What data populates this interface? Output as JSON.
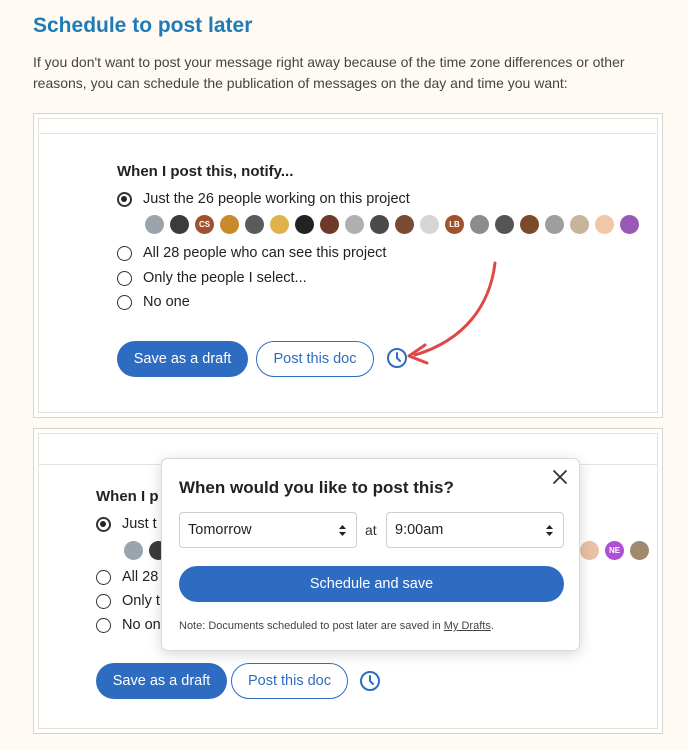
{
  "article": {
    "heading": "Schedule to post later",
    "intro": "If you don't want to post your message right away because of the time zone differences or other reasons, you can schedule the publication of messages on the day and time you want:"
  },
  "notify": {
    "title": "When I post this, notify...",
    "title_partial": "When I p",
    "options": [
      {
        "label": "Just the 26 people working on this project",
        "selected": true
      },
      {
        "label": "All 28 people who can see this project",
        "selected": false
      },
      {
        "label": "Only the people I select...",
        "selected": false
      },
      {
        "label": "No one",
        "selected": false
      }
    ],
    "options_partial": [
      "Just t",
      "All 28",
      "Only t",
      "No on"
    ],
    "avatars_top": [
      {
        "initials": "",
        "color": "#9aa4ad"
      },
      {
        "initials": "",
        "color": "#3b3b3b"
      },
      {
        "initials": "CS",
        "color": "#a0522d"
      },
      {
        "initials": "",
        "color": "#c98a2b"
      },
      {
        "initials": "",
        "color": "#5b5b5b"
      },
      {
        "initials": "",
        "color": "#e0b24a"
      },
      {
        "initials": "",
        "color": "#222222"
      },
      {
        "initials": "",
        "color": "#6b3a2a"
      },
      {
        "initials": "",
        "color": "#b0b0b0"
      },
      {
        "initials": "",
        "color": "#4a4a4a"
      },
      {
        "initials": "",
        "color": "#7a4a33"
      },
      {
        "initials": "",
        "color": "#d6d6d6"
      },
      {
        "initials": "LB",
        "color": "#a0522d"
      },
      {
        "initials": "",
        "color": "#8c8c8c"
      },
      {
        "initials": "",
        "color": "#555555"
      },
      {
        "initials": "",
        "color": "#7b4a2a"
      },
      {
        "initials": "",
        "color": "#9e9e9e"
      },
      {
        "initials": "",
        "color": "#c7b49a"
      },
      {
        "initials": "",
        "color": "#f2c6a8"
      },
      {
        "initials": "",
        "color": "#9b59b6"
      }
    ],
    "avatars_bottom_left": [
      {
        "initials": "",
        "color": "#9aa4ad"
      },
      {
        "initials": "",
        "color": "#3b3b3b"
      }
    ],
    "avatars_bottom_right": [
      {
        "initials": "",
        "color": "#e8c1a6"
      },
      {
        "initials": "NE",
        "color": "#b04fd6"
      },
      {
        "initials": "",
        "color": "#a0896e"
      }
    ]
  },
  "actions": {
    "save_draft": "Save as a draft",
    "post_doc": "Post this doc"
  },
  "schedule_modal": {
    "title": "When would you like to post this?",
    "day_value": "Tomorrow",
    "at_label": "at",
    "time_value": "9:00am",
    "submit": "Schedule and save",
    "note_prefix": "Note: Documents scheduled to post later are saved in ",
    "note_link": "My Drafts",
    "note_suffix": "."
  },
  "icons": {
    "clock": "clock-icon",
    "close": "close-icon",
    "caret": "select-caret-icon",
    "arrow": "annotation-arrow"
  },
  "colors": {
    "primary": "#2e6cc1",
    "heading": "#1f7bb8",
    "arrow": "#e04848",
    "page_bg": "#fffaf3"
  }
}
